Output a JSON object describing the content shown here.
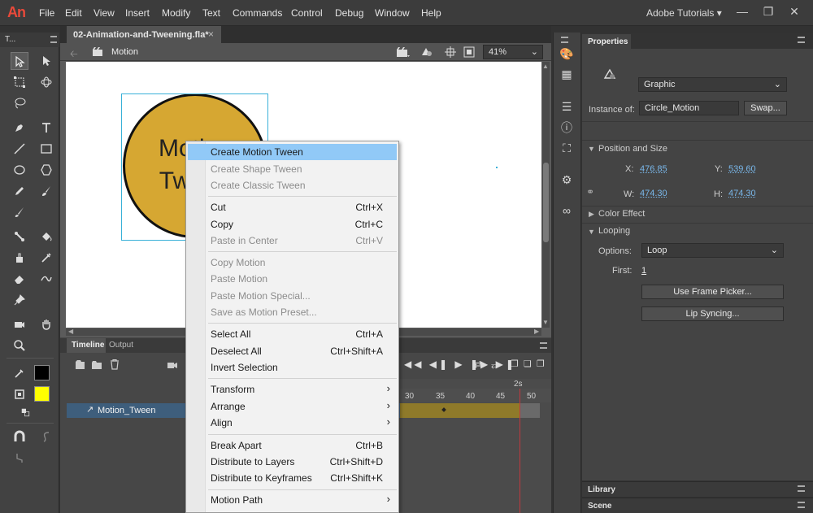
{
  "app": {
    "logo": "An"
  },
  "menubar": {
    "items": [
      "File",
      "Edit",
      "View",
      "Insert",
      "Modify",
      "Text",
      "Commands",
      "Control",
      "Debug",
      "Window",
      "Help"
    ],
    "workspace": "Adobe Tutorials ▾"
  },
  "tools": {
    "title": "T..."
  },
  "document": {
    "tab_title": "02-Animation-and-Tweening.fla*",
    "close_glyph": "×",
    "scene": "Motion",
    "zoom": "41%"
  },
  "stage": {
    "circle_text": "Motion Tween"
  },
  "timeline": {
    "tabs": [
      "Timeline",
      "Output"
    ],
    "ruler_ticks": [
      "30",
      "35",
      "40",
      "45",
      "50"
    ],
    "seconds_label": "2s",
    "layer_name": "Motion_Tween"
  },
  "properties": {
    "title": "Properties",
    "symbol_type": "Graphic",
    "instance_of_label": "Instance of:",
    "instance_of_value": "Circle_Motion",
    "swap_label": "Swap...",
    "position_size_title": "Position and Size",
    "x_label": "X:",
    "x_value": "476.85",
    "y_label": "Y:",
    "y_value": "539.60",
    "w_label": "W:",
    "w_value": "474.30",
    "h_label": "H:",
    "h_value": "474.30",
    "color_effect_title": "Color Effect",
    "looping_title": "Looping",
    "options_label": "Options:",
    "options_value": "Loop",
    "first_label": "First:",
    "first_value": "1",
    "frame_picker_label": "Use Frame Picker...",
    "lip_sync_label": "Lip Syncing...",
    "library_label": "Library",
    "scene_label": "Scene"
  },
  "context_menu": {
    "items": [
      {
        "label": "Create Motion Tween",
        "shortcut": "",
        "state": "highlighted"
      },
      {
        "label": "Create Shape Tween",
        "shortcut": "",
        "state": "disabled"
      },
      {
        "label": "Create Classic Tween",
        "shortcut": "",
        "state": "disabled"
      },
      {
        "label": "Cut",
        "shortcut": "Ctrl+X",
        "state": "enabled"
      },
      {
        "label": "Copy",
        "shortcut": "Ctrl+C",
        "state": "enabled"
      },
      {
        "label": "Paste in Center",
        "shortcut": "Ctrl+V",
        "state": "disabled"
      },
      {
        "label": "Copy Motion",
        "shortcut": "",
        "state": "disabled"
      },
      {
        "label": "Paste Motion",
        "shortcut": "",
        "state": "disabled"
      },
      {
        "label": "Paste Motion Special...",
        "shortcut": "",
        "state": "disabled"
      },
      {
        "label": "Save as Motion Preset...",
        "shortcut": "",
        "state": "disabled"
      },
      {
        "label": "Select All",
        "shortcut": "Ctrl+A",
        "state": "enabled"
      },
      {
        "label": "Deselect All",
        "shortcut": "Ctrl+Shift+A",
        "state": "enabled"
      },
      {
        "label": "Invert Selection",
        "shortcut": "",
        "state": "enabled"
      },
      {
        "label": "Transform",
        "shortcut": "",
        "state": "submenu"
      },
      {
        "label": "Arrange",
        "shortcut": "",
        "state": "submenu"
      },
      {
        "label": "Align",
        "shortcut": "",
        "state": "submenu"
      },
      {
        "label": "Break Apart",
        "shortcut": "Ctrl+B",
        "state": "enabled"
      },
      {
        "label": "Distribute to Layers",
        "shortcut": "Ctrl+Shift+D",
        "state": "enabled"
      },
      {
        "label": "Distribute to Keyframes",
        "shortcut": "Ctrl+Shift+K",
        "state": "enabled"
      },
      {
        "label": "Motion Path",
        "shortcut": "",
        "state": "submenu"
      }
    ],
    "submenu_glyph": "›"
  },
  "colors": {
    "stroke_swatch": "#000000",
    "fill_swatch": "#ffff00",
    "circle_fill": "#d6a732",
    "menu_highlight": "#91c9f7",
    "selected_layer": "#3e5e7c"
  }
}
